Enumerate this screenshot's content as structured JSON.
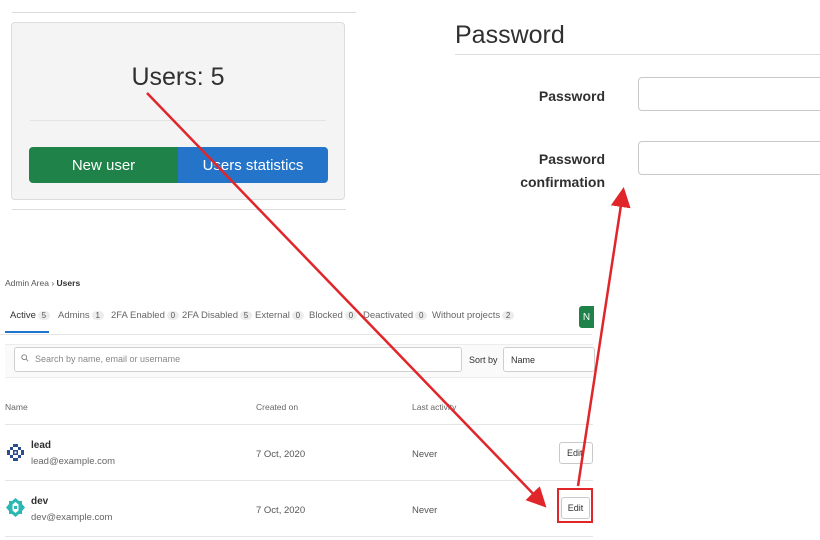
{
  "users_card": {
    "title": "Users: 5",
    "new_user_label": "New user",
    "stats_label": "Users statistics"
  },
  "password_form": {
    "title": "Password",
    "password_label": "Password",
    "confirm_label_line1": "Password",
    "confirm_label_line2": "confirmation",
    "password_value": "",
    "confirm_value": ""
  },
  "breadcrumb": {
    "root": "Admin Area",
    "separator": "›",
    "current": "Users"
  },
  "tabs": [
    {
      "label": "Active",
      "count": "5"
    },
    {
      "label": "Admins",
      "count": "1"
    },
    {
      "label": "2FA Enabled",
      "count": "0"
    },
    {
      "label": "2FA Disabled",
      "count": "5"
    },
    {
      "label": "External",
      "count": "0"
    },
    {
      "label": "Blocked",
      "count": "0"
    },
    {
      "label": "Deactivated",
      "count": "0"
    },
    {
      "label": "Without projects",
      "count": "2"
    }
  ],
  "new_user_stub_label": "N",
  "search": {
    "placeholder": "Search by name, email or username",
    "icon": "search-icon"
  },
  "sort": {
    "label": "Sort by",
    "selected": "Name"
  },
  "table": {
    "headers": [
      "Name",
      "Created on",
      "Last activity"
    ],
    "rows": [
      {
        "name": "lead",
        "email": "lead@example.com",
        "created": "7 Oct, 2020",
        "last_activity": "Never",
        "action": "Edit",
        "avatar": "identicon-blue"
      },
      {
        "name": "dev",
        "email": "dev@example.com",
        "created": "7 Oct, 2020",
        "last_activity": "Never",
        "action": "Edit",
        "avatar": "identicon-teal"
      }
    ]
  },
  "colors": {
    "green": "#1f8248",
    "blue": "#2474c9",
    "annotation_red": "#e0262b",
    "avatar_blue": "#2a4d8f",
    "avatar_teal": "#2bb7b3"
  }
}
